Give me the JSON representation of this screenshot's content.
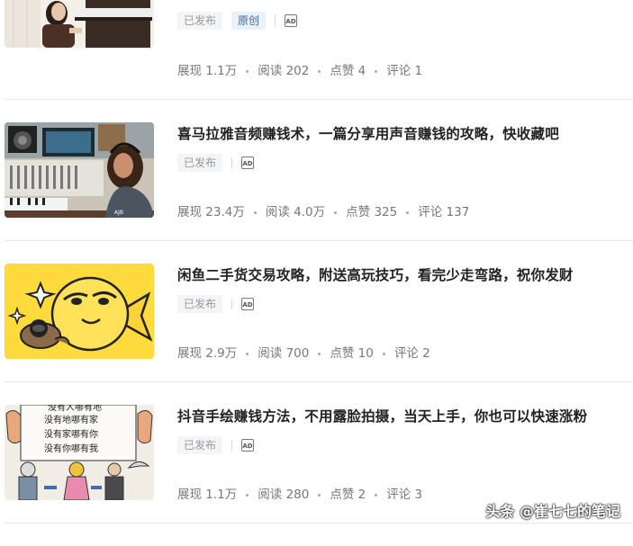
{
  "articles": [
    {
      "title": "",
      "thumb_icon": "piano-girl-thumbnail",
      "status": "已发布",
      "original": "原创",
      "ad": "AD",
      "stats": [
        {
          "label": "展现",
          "value": "1.1万"
        },
        {
          "label": "阅读",
          "value": "202"
        },
        {
          "label": "点赞",
          "value": "4"
        },
        {
          "label": "评论",
          "value": "1"
        }
      ]
    },
    {
      "title": "喜马拉雅音频赚钱术，一篇分享用声音赚钱的攻略，快收藏吧",
      "thumb_icon": "recording-studio-thumbnail",
      "status": "已发布",
      "ad": "AD",
      "stats": [
        {
          "label": "展现",
          "value": "23.4万"
        },
        {
          "label": "阅读",
          "value": "4.0万"
        },
        {
          "label": "点赞",
          "value": "325"
        },
        {
          "label": "评论",
          "value": "137"
        }
      ]
    },
    {
      "title": "闲鱼二手货交易攻略，附送高玩技巧，看完少走弯路，祝你发财",
      "thumb_icon": "xianyu-fish-thumbnail",
      "status": "已发布",
      "ad": "AD",
      "stats": [
        {
          "label": "展现",
          "value": "2.9万"
        },
        {
          "label": "阅读",
          "value": "700"
        },
        {
          "label": "点赞",
          "value": "10"
        },
        {
          "label": "评论",
          "value": "2"
        }
      ]
    },
    {
      "title": "抖音手绘赚钱方法，不用露脸拍摄，当天上手，你也可以快速涨粉",
      "thumb_icon": "hand-drawn-comic-thumbnail",
      "thumb_lines": [
        "没有人哪有地",
        "没有地哪有家",
        "没有家哪有你",
        "没有你哪有我"
      ],
      "status": "已发布",
      "ad": "AD",
      "stats": [
        {
          "label": "展现",
          "value": "1.1万"
        },
        {
          "label": "阅读",
          "value": "280"
        },
        {
          "label": "点赞",
          "value": "2"
        },
        {
          "label": "评论",
          "value": "3"
        }
      ]
    }
  ],
  "watermark": "头条 @崔七七的笔记",
  "colors": {
    "tag_bg": "#f4f5f6",
    "original_bg": "#e9f2fc",
    "original_text": "#406599",
    "divider": "#e8e8e8",
    "meta_text": "#777777"
  }
}
